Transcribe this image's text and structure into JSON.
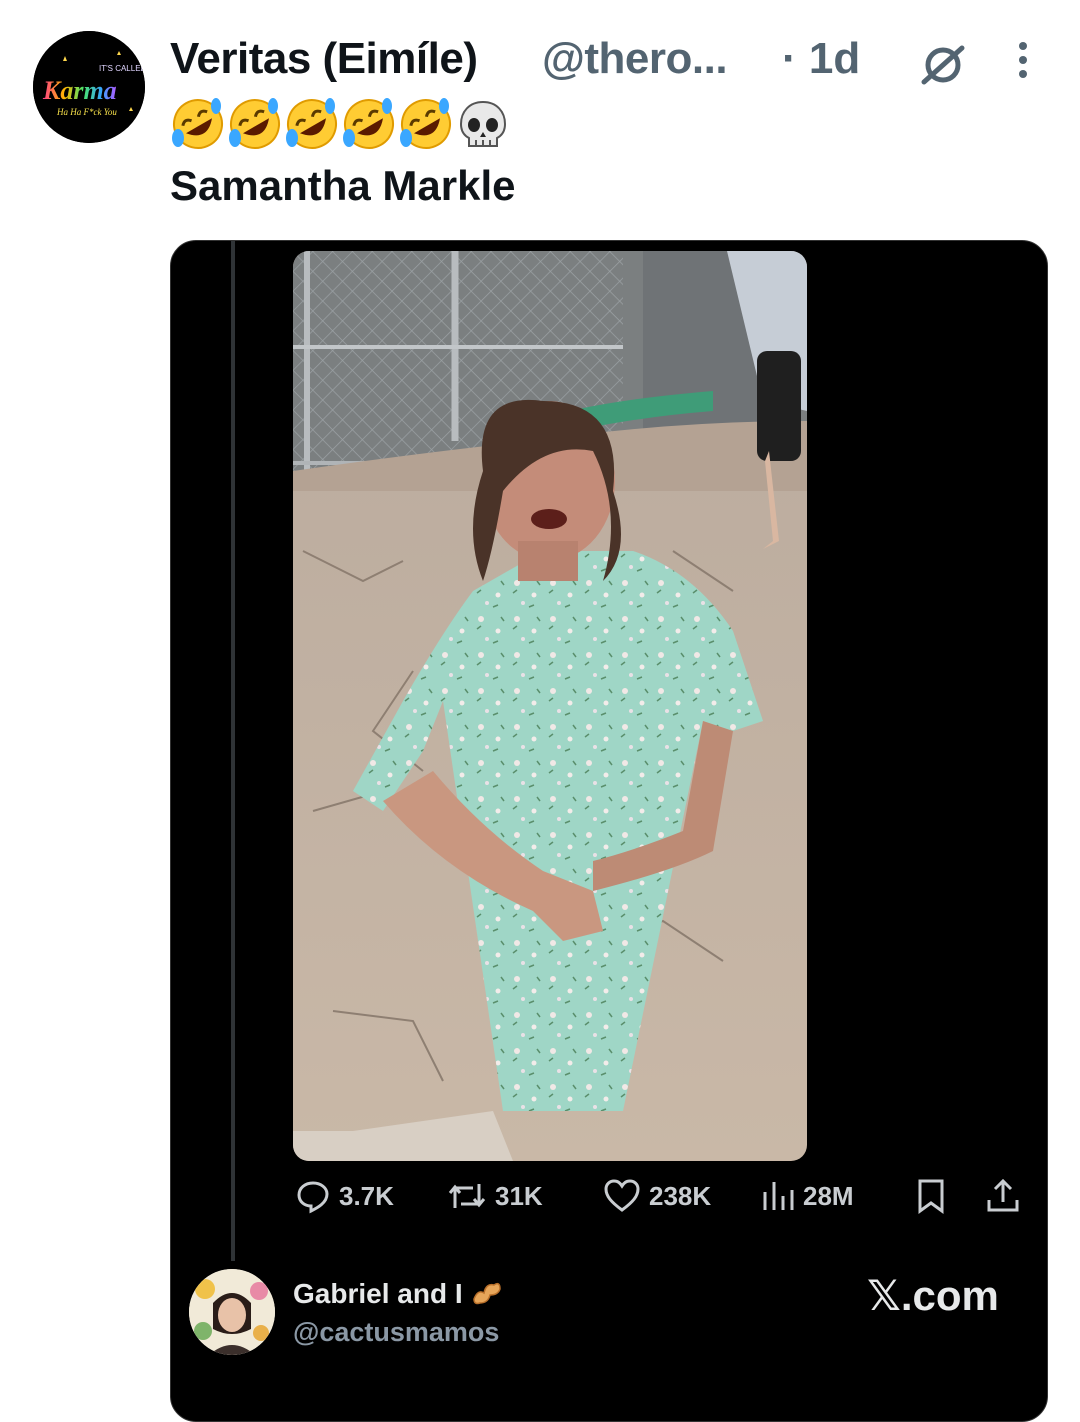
{
  "post": {
    "display_name": "Veritas (Eimíle)",
    "handle": "@thero...",
    "time": "· 1d",
    "emojis": [
      "rolling-on-floor-laughing",
      "rolling-on-floor-laughing",
      "rolling-on-floor-laughing",
      "rolling-on-floor-laughing",
      "rolling-on-floor-laughing",
      "skull"
    ],
    "text": "Samantha Markle"
  },
  "avatar": {
    "line1": "IT'S CALLED",
    "line2": "Karma",
    "line3": "Ha Ha F*ck You"
  },
  "video": {
    "muted": true
  },
  "actions": {
    "replies": "3.7K",
    "reposts": "31K",
    "likes": "238K",
    "views": "28M"
  },
  "quoted": {
    "name": "Gabriel and I",
    "handle": "@cactusmamos",
    "source": "𝕏.com"
  },
  "colors": {
    "accent_grey": "#536471",
    "card_bg": "#000000",
    "text_primary": "#0f1419"
  }
}
